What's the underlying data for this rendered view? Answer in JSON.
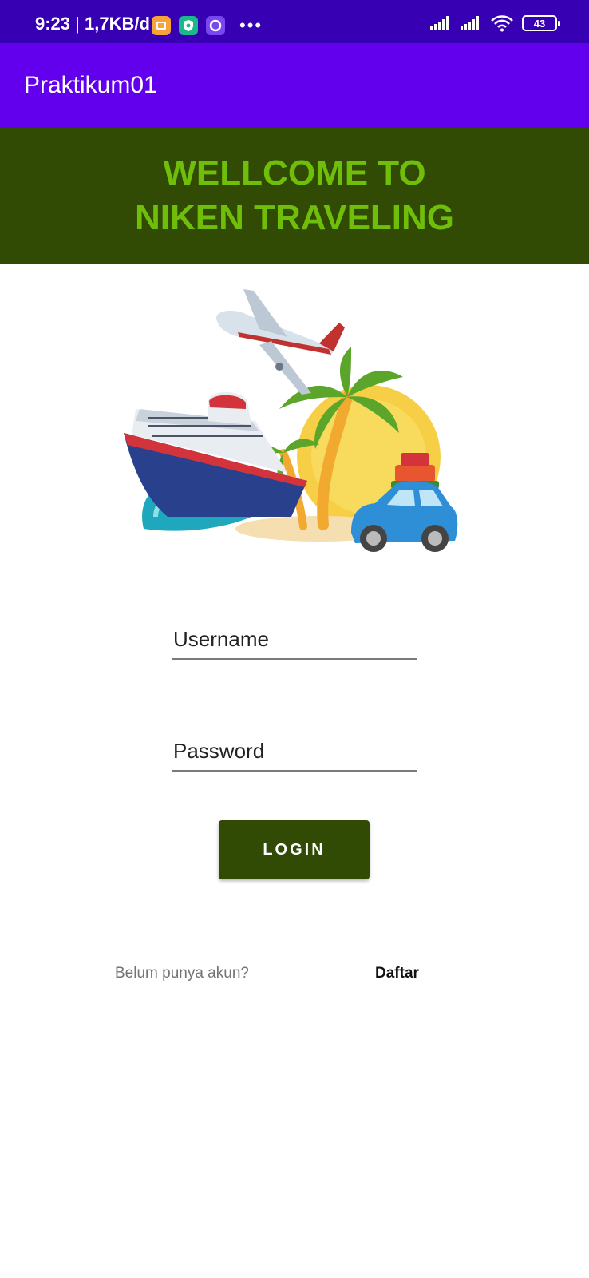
{
  "status_bar": {
    "time": "9:23",
    "speed": "1,7KB/d",
    "battery": "43",
    "background": "#3700b3"
  },
  "app_bar": {
    "title": "Praktikum01",
    "background": "#6200ee"
  },
  "welcome": {
    "line1": "WELLCOME TO",
    "line2": "NIKEN TRAVELING",
    "background": "#314a04",
    "text_color": "#6fbf0a"
  },
  "form": {
    "username_placeholder": "Username",
    "password_placeholder": "Password",
    "login_label": "LOGIN"
  },
  "signup": {
    "prompt": "Belum punya akun?",
    "link": "Daftar"
  },
  "icons": {
    "notif": [
      "gallery-icon",
      "shield-icon",
      "circle-app-icon"
    ],
    "system": [
      "signal-icon",
      "signal-icon",
      "wifi-icon",
      "battery-icon"
    ]
  }
}
